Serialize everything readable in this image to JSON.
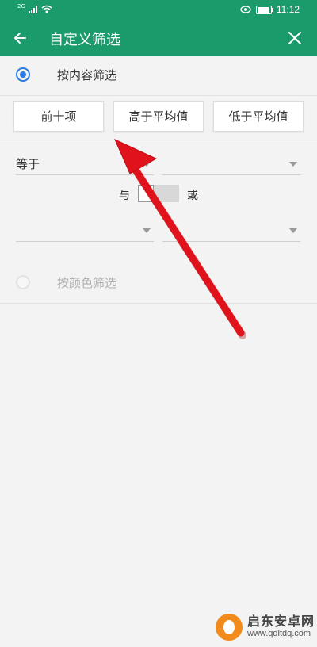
{
  "status_bar": {
    "network": "2G",
    "time": "11:12",
    "battery_level": 0.9,
    "icons": [
      "signal-icon",
      "wifi-icon",
      "eye-icon",
      "battery-icon"
    ]
  },
  "app_bar": {
    "title": "自定义筛选",
    "back_icon": "arrow-left-icon",
    "close_icon": "close-icon"
  },
  "filter_modes": {
    "by_content": {
      "label": "按内容筛选",
      "selected": true
    },
    "by_color": {
      "label": "按颜色筛选",
      "selected": false
    }
  },
  "quick_buttons": {
    "top_ten": "前十项",
    "above_average": "高于平均值",
    "below_average": "低于平均值"
  },
  "condition_1": {
    "operator": "等于",
    "value": ""
  },
  "logic": {
    "and_label": "与",
    "or_label": "或"
  },
  "condition_2": {
    "operator": "",
    "value": ""
  },
  "watermark": {
    "name": "启东安卓网",
    "url": "www.qdltdq.com"
  },
  "colors": {
    "accent": "#1b9b6b",
    "radio": "#2a7de1",
    "annotation": "#e0121b"
  }
}
